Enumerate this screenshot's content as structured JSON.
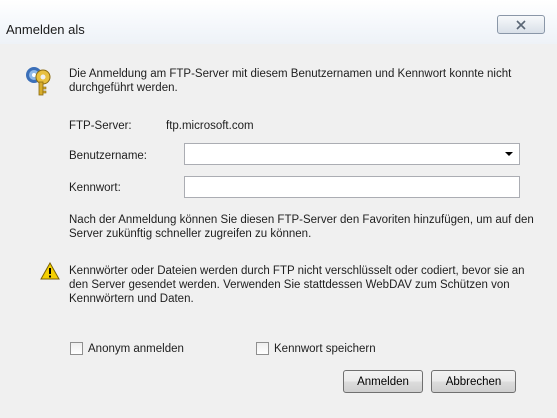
{
  "window": {
    "title": "Anmelden als"
  },
  "dialog": {
    "message": "Die Anmeldung am FTP-Server mit diesem Benutzernamen und Kennwort konnte nicht durchgeführt werden.",
    "ftp_server_label": "FTP-Server:",
    "ftp_server_value": "ftp.microsoft.com",
    "username_label": "Benutzername:",
    "username_value": "",
    "password_label": "Kennwort:",
    "password_value": "",
    "info_text": "Nach der Anmeldung können Sie diesen FTP-Server den Favoriten hinzufügen, um auf den Server zukünftig schneller zugreifen zu können.",
    "warning_text": "Kennwörter oder Dateien werden durch FTP nicht verschlüsselt oder codiert, bevor sie an den Server gesendet werden. Verwenden Sie stattdessen WebDAV zum Schützen von Kennwörtern und Daten.",
    "anonymous_label": "Anonym anmelden",
    "save_password_label": "Kennwort speichern",
    "login_button": "Anmelden",
    "cancel_button": "Abbrechen"
  },
  "icons": {
    "title_close": "close-icon",
    "key": "key-icon",
    "warning": "warning-icon"
  }
}
